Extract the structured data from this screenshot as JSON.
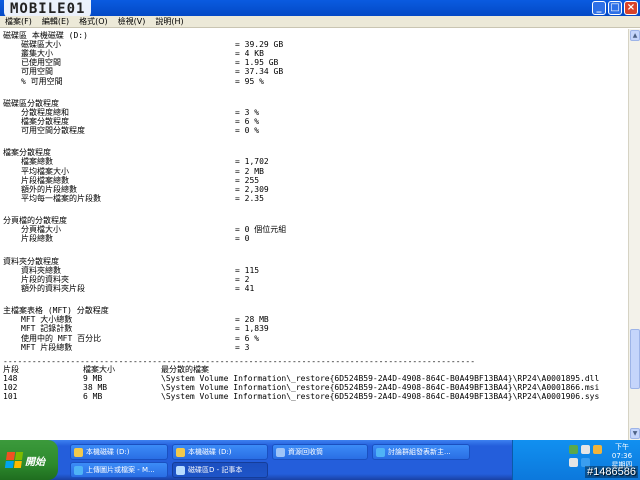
{
  "watermark": "MOBILE01",
  "menu": [
    "檔案(F)",
    "編輯(E)",
    "格式(O)",
    "檢視(V)",
    "說明(H)"
  ],
  "report": {
    "volume": {
      "header": "磁碟區 本機磁碟 (D:)",
      "rows": [
        {
          "label": "磁碟區大小",
          "value": "= 39.29 GB"
        },
        {
          "label": "叢集大小",
          "value": "= 4 KB"
        },
        {
          "label": "已使用空間",
          "value": "= 1.95 GB"
        },
        {
          "label": "可用空間",
          "value": "= 37.34 GB"
        },
        {
          "label": "% 可用空間",
          "value": "= 95 %"
        }
      ]
    },
    "volume_frag": {
      "header": "磁碟區分散程度",
      "rows": [
        {
          "label": "分散程度總和",
          "value": "= 3 %"
        },
        {
          "label": "檔案分散程度",
          "value": "= 6 %"
        },
        {
          "label": "可用空間分散程度",
          "value": "= 0 %"
        }
      ]
    },
    "file_frag": {
      "header": "檔案分散程度",
      "rows": [
        {
          "label": "檔案總數",
          "value": "= 1,702"
        },
        {
          "label": "平均檔案大小",
          "value": "= 2 MB"
        },
        {
          "label": "片段檔案總數",
          "value": "= 255"
        },
        {
          "label": "額外的片段總數",
          "value": "= 2,309"
        },
        {
          "label": "平均每一檔案的片段數",
          "value": "= 2.35"
        }
      ]
    },
    "pagefile": {
      "header": "分頁檔的分散程度",
      "rows": [
        {
          "label": "分頁檔大小",
          "value": "= 0 個位元組"
        },
        {
          "label": "片段總數",
          "value": "= 0"
        }
      ]
    },
    "folder_frag": {
      "header": "資料夾分散程度",
      "rows": [
        {
          "label": "資料夾總數",
          "value": "= 115"
        },
        {
          "label": "片段的資料夾",
          "value": "= 2"
        },
        {
          "label": "額外的資料夾片段",
          "value": "= 41"
        }
      ]
    },
    "mft": {
      "header": "主檔案表格 (MFT) 分散程度",
      "rows": [
        {
          "label": "MFT 大小總數",
          "value": "= 28 MB"
        },
        {
          "label": "MFT 記錄計數",
          "value": "= 1,839"
        },
        {
          "label": "使用中的 MFT 百分比",
          "value": "= 6 %"
        },
        {
          "label": "MFT 片段總數",
          "value": "= 3"
        }
      ]
    },
    "separator": "--------------------------------------------------------------------------------------------------",
    "table": {
      "headers": [
        "片段",
        "檔案大小",
        "最分散的檔案"
      ],
      "rows": [
        [
          "148",
          "9 MB",
          "\\System Volume Information\\_restore{6D524B59-2A4D-4908-864C-B0A49BF13BA4}\\RP24\\A0001895.dll"
        ],
        [
          "102",
          "38 MB",
          "\\System Volume Information\\_restore{6D524B59-2A4D-4908-864C-B0A49BF13BA4}\\RP24\\A0001866.msi"
        ],
        [
          "101",
          "6 MB",
          "\\System Volume Information\\_restore{6D524B59-2A4D-4908-864C-B0A49BF13BA4}\\RP24\\A0001906.sys"
        ]
      ]
    }
  },
  "taskbar": {
    "start_label": "開始",
    "tasks": [
      {
        "label": "本機磁碟 (D:)",
        "icon_color": "#f2c94c"
      },
      {
        "label": "本機磁碟 (D:)",
        "icon_color": "#f2c94c"
      },
      {
        "label": "資源回收筒",
        "icon_color": "#9fc5f8"
      },
      {
        "label": "討論群組發表新主...",
        "icon_color": "#4fb3f6"
      },
      {
        "label": "上傳圖片或檔案 - M...",
        "icon_color": "#4fb3f6"
      },
      {
        "label": "磁碟區D - 記事本",
        "icon_color": "#b8dcff"
      }
    ],
    "clock_time": "下午 07:36",
    "clock_day": "星期四",
    "photo_id": "#1486586"
  }
}
